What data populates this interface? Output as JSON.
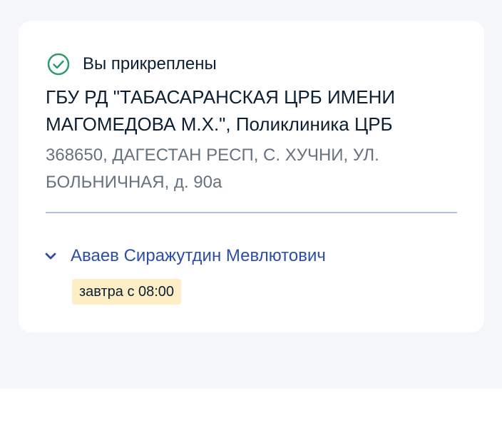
{
  "status": {
    "icon": "check-circle-icon",
    "label": "Вы прикреплены",
    "color": "#2e9b6b"
  },
  "organization": {
    "name": "ГБУ РД \"ТАБАСАРАНСКАЯ ЦРБ ИМЕНИ МАГОМЕДОВА М.Х.\", Поликлиника ЦРБ",
    "address": "368650, ДАГЕСТАН РЕСП, С. ХУЧНИ, УЛ. БОЛЬНИЧНАЯ, д. 90а"
  },
  "doctor": {
    "icon": "chevron-down-icon",
    "name": "Аваев Сиражутдин Мевлютович",
    "availability": "завтра с 08:00",
    "link_color": "#2c4ea4",
    "badge_color": "#fdeec6"
  }
}
